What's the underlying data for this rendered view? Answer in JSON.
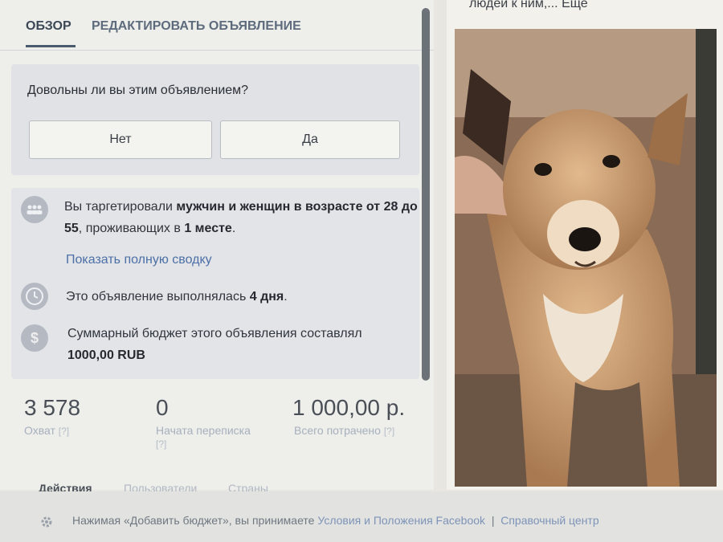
{
  "tabs": [
    {
      "label": "ОБЗОР"
    },
    {
      "label": "РЕДАКТИРОВАТЬ ОБЪЯВЛЕНИЕ"
    }
  ],
  "survey": {
    "question": "Довольны ли вы этим объявлением?",
    "no_label": "Нет",
    "yes_label": "Да"
  },
  "targeting": {
    "part1": "Вы таргетировали ",
    "bold1": "мужчин и женщин в возрасте от 28 до 55",
    "part2": ", проживающих в ",
    "bold2": "1 месте",
    "part3": ".",
    "link": "Показать полную сводку"
  },
  "duration": {
    "part1": "Это объявление выполнялась ",
    "bold": "4 дня",
    "part2": "."
  },
  "budget": {
    "text": "Суммарный бюджет этого объявления составлял",
    "amount": "1000,00 RUB"
  },
  "metrics": [
    {
      "value": "3 578",
      "label": "Охват",
      "help": "[?]"
    },
    {
      "value": "0",
      "label": "Начата переписка",
      "help": "[?]"
    },
    {
      "value": "1 000,00 р.",
      "label": "Всего потрачено",
      "help": "[?]"
    }
  ],
  "bottom_tabs": [
    "Действия",
    "Пользователи",
    "Страны"
  ],
  "ad": {
    "text_fragment": "людей к ним,...",
    "more_link": "Еще"
  },
  "footer": {
    "part1": "Нажимая «Добавить бюджет», вы принимаете ",
    "terms_link": "Условия и Положения Facebook",
    "separator": "|",
    "help_link": "Справочный центр"
  },
  "colors": {
    "accent_link": "#4b6fa6",
    "tab_active": "#3c4856"
  }
}
